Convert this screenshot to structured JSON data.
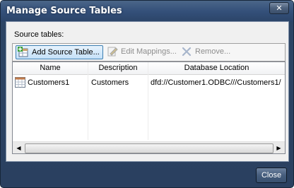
{
  "window": {
    "title": "Manage Source Tables",
    "close_glyph": "✕"
  },
  "source_tables_label": "Source tables:",
  "toolbar": {
    "add": {
      "label": "Add Source Table...",
      "icon": "add-table-icon",
      "enabled": true
    },
    "edit": {
      "label": "Edit Mappings...",
      "icon": "edit-mappings-icon",
      "enabled": false
    },
    "remove": {
      "label": "Remove...",
      "icon": "remove-icon",
      "enabled": false
    }
  },
  "table": {
    "columns": [
      "Name",
      "Description",
      "Database Location"
    ],
    "rows": [
      {
        "name": "Customers1",
        "description": "Customers",
        "location": "dfd://Customer1.ODBC///Customers1/",
        "icon": "table-icon"
      }
    ]
  },
  "scrollbar": {
    "left_arrow": "◀",
    "right_arrow": "▶"
  },
  "footer": {
    "close_label": "Close"
  },
  "colors": {
    "title_bar": "#34507a",
    "accent": "#3c7fb1"
  }
}
